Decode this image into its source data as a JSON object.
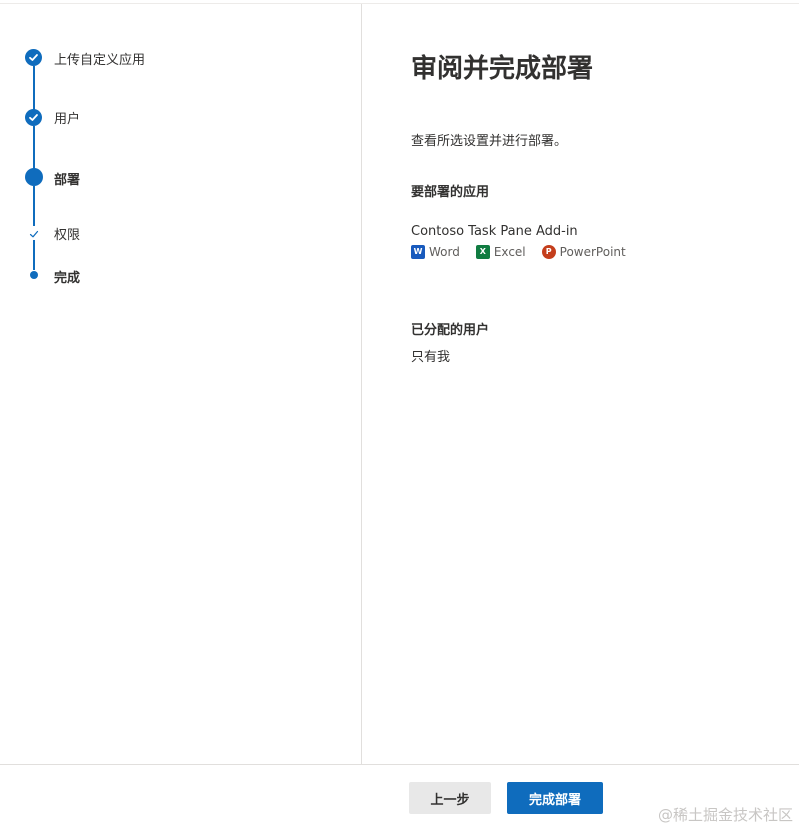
{
  "steps": [
    {
      "label": "上传自定义应用",
      "state": "done"
    },
    {
      "label": "用户",
      "state": "done"
    },
    {
      "label": "部署",
      "state": "current"
    },
    {
      "label": "权限",
      "state": "sub-done"
    },
    {
      "label": "完成",
      "state": "sub-current"
    }
  ],
  "main": {
    "title": "审阅并完成部署",
    "description": "查看所选设置并进行部署。",
    "apps_heading": "要部署的应用",
    "app_name": "Contoso Task Pane Add-in",
    "hosts": [
      {
        "label": "Word",
        "icon": "word-icon",
        "color": "#185abd"
      },
      {
        "label": "Excel",
        "icon": "excel-icon",
        "color": "#107c41"
      },
      {
        "label": "PowerPoint",
        "icon": "powerpoint-icon",
        "color": "#c43e1c"
      }
    ],
    "users_heading": "已分配的用户",
    "users_value": "只有我"
  },
  "footer": {
    "back_label": "上一步",
    "finish_label": "完成部署",
    "watermark": "@稀土掘金技术社区"
  },
  "colors": {
    "accent": "#0f6cbd"
  }
}
